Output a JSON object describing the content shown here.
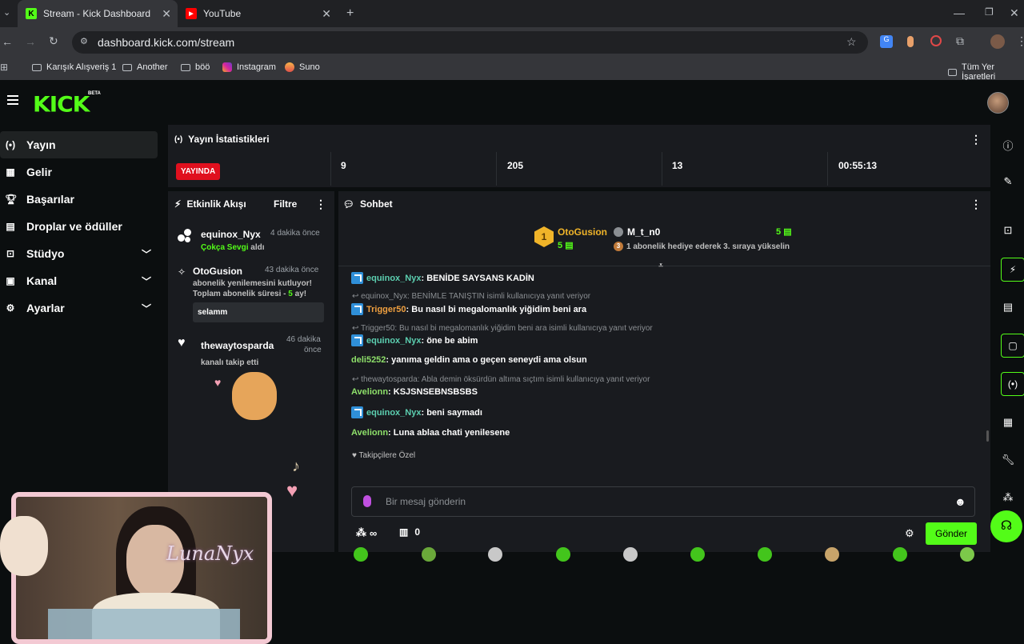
{
  "browser": {
    "tabs": [
      {
        "title": "Stream - Kick Dashboard",
        "active": true
      },
      {
        "title": "YouTube",
        "active": false
      }
    ],
    "url": "dashboard.kick.com/stream",
    "bookmarks": [
      "Karışık Alışveriş 1",
      "Another",
      "böö",
      "Instagram",
      "Suno"
    ],
    "all_bookmarks": "Tüm Yer İşaretleri"
  },
  "app": {
    "logo": "KICK",
    "beta": "BETA",
    "accent": "#53fc18"
  },
  "sidebar": {
    "items": [
      {
        "label": "Yayın",
        "icon": "broadcast-icon"
      },
      {
        "label": "Gelir",
        "icon": "revenue-icon"
      },
      {
        "label": "Başarılar",
        "icon": "trophy-icon"
      },
      {
        "label": "Droplar ve ödüller",
        "icon": "gift-icon"
      },
      {
        "label": "Stüdyo",
        "icon": "studio-icon"
      },
      {
        "label": "Kanal",
        "icon": "channel-icon"
      },
      {
        "label": "Ayarlar",
        "icon": "gear-icon"
      }
    ]
  },
  "stats": {
    "title": "Yayın İstatistikleri",
    "live": "YAYINDA",
    "viewers": "9",
    "followers": "205",
    "subs": "13",
    "duration": "00:55:13"
  },
  "activity": {
    "title": "Etkinlik Akışı",
    "filter": "Filtre",
    "events": [
      {
        "name": "equinox_Nyx",
        "time": "4 dakika önce",
        "highlight": "Çokça Sevgi",
        "rest": " aldı"
      },
      {
        "name": "OtoGusion",
        "time": "43 dakika önce",
        "line1": "abonelik yenilemesini kutluyor!",
        "line2a": "Toplam abonelik süresi - ",
        "line2b": "5",
        "line2c": " ay!",
        "message": "selamm"
      },
      {
        "name": "thewaytosparda",
        "time1": "46 dakika",
        "time2": "önce",
        "sub": "kanalı takip etti"
      }
    ]
  },
  "chat": {
    "title": "Sohbet",
    "pinned": {
      "rank": "1",
      "user1": "OtoGusion",
      "count1": "5",
      "user2": "M_t_n0",
      "count2": "5",
      "note": "1 abonelik hediye ederek 3. sıraya yükselin",
      "note_num": "3"
    },
    "messages": [
      {
        "user": "equinox_Nyx",
        "text": ": BENİDE SAYSANS KADİN",
        "color": "#5ccfb0",
        "badge": true
      },
      {
        "reply": "equinox_Nyx: BENİMLE TANIŞTIN isimli kullanıcıya yanıt veriyor"
      },
      {
        "user": "Trigger50",
        "text": ": Bu nasıl bi megalomanlık yiğidim beni ara",
        "color": "#f0a040",
        "badge": true
      },
      {
        "reply": "Trigger50: Bu nasıl bi megalomanlık yiğidim beni ara isimli kullanıcıya yanıt veriyor"
      },
      {
        "user": "equinox_Nyx",
        "text": ": öne be abim",
        "color": "#5ccfb0",
        "badge": true
      },
      {
        "user": "deli5252",
        "text": ": yanıma geldin ama o geçen seneydi ama olsun",
        "color": "#8ee06a",
        "badge": false
      },
      {
        "reply": "thewaytosparda: Abla demin öksürdün altıma sıçtım isimli kullanıcıya yanıt veriyor"
      },
      {
        "user": "Avelionn",
        "text": ": KSJSNSEBNSBSBS",
        "color": "#8ee06a",
        "badge": false
      },
      {
        "user": "equinox_Nyx",
        "text": ": beni saymadı",
        "color": "#5ccfb0",
        "badge": true
      },
      {
        "user": "Avelionn",
        "text": ": Luna ablaa chati yenilesene",
        "color": "#8ee06a",
        "badge": false
      }
    ],
    "followers_only": "Takipçilere Özel",
    "placeholder": "Bir mesaj gönderin",
    "points": "∞",
    "store_count": "0",
    "send": "Gönder"
  },
  "overlay": {
    "watermark": "LunaNyx"
  }
}
